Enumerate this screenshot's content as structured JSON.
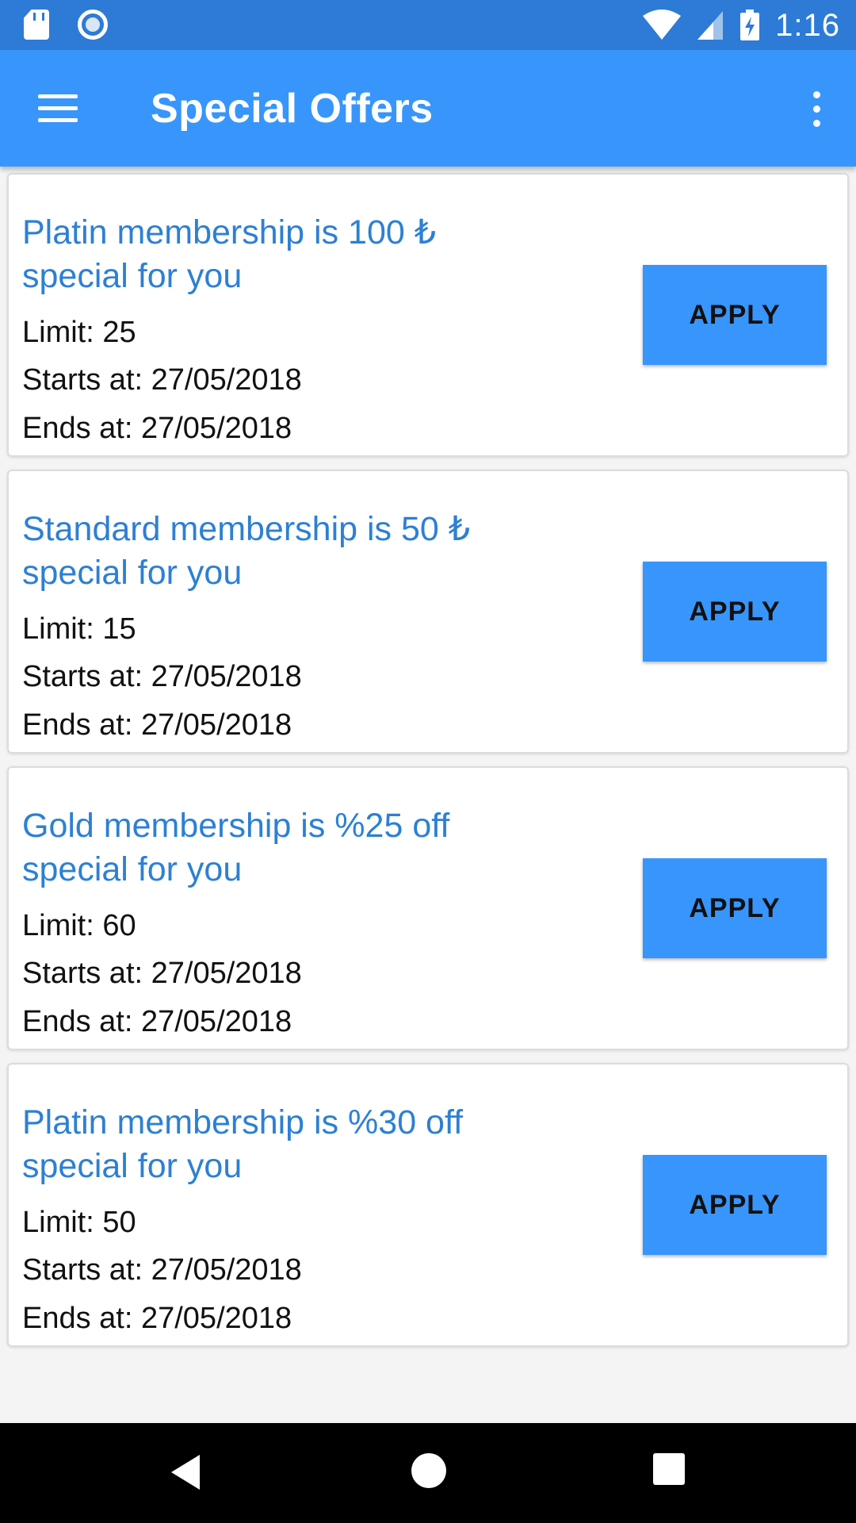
{
  "status_bar": {
    "time": "1:16",
    "icons": [
      "sd-card-icon",
      "record-icon",
      "wifi-icon",
      "signal-icon",
      "battery-charging-icon"
    ]
  },
  "app_bar": {
    "title": "Special Offers",
    "menu_icon": "hamburger-menu-icon",
    "overflow_icon": "more-vert-icon"
  },
  "offers": [
    {
      "title": "Platin membership is 100 ₺ special for you",
      "limit": "Limit: 25",
      "starts": "Starts at: 27/05/2018",
      "ends": "Ends at: 27/05/2018",
      "button": "APPLY"
    },
    {
      "title": "Standard membership is 50 ₺ special for you",
      "limit": "Limit: 15",
      "starts": "Starts at: 27/05/2018",
      "ends": "Ends at: 27/05/2018",
      "button": "APPLY"
    },
    {
      "title": "Gold membership is %25 off special for you",
      "limit": "Limit: 60",
      "starts": "Starts at: 27/05/2018",
      "ends": "Ends at: 27/05/2018",
      "button": "APPLY"
    },
    {
      "title": "Platin membership is %30 off special for you",
      "limit": "Limit: 50",
      "starts": "Starts at: 27/05/2018",
      "ends": "Ends at: 27/05/2018",
      "button": "APPLY"
    }
  ],
  "nav_bar": {
    "icons": [
      "back-icon",
      "home-icon",
      "recents-icon"
    ]
  },
  "colors": {
    "status_bar": "#2d7bd6",
    "app_bar": "#3895fb",
    "offer_title": "#2d80d3",
    "button": "#3895fb"
  }
}
